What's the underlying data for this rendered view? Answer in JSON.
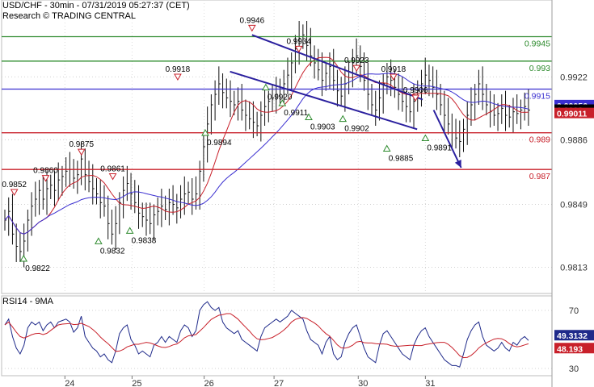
{
  "header": {
    "title": "USD/CHF - 30min - 07/31/2019 05:27:37 (CET)",
    "source": "Research © TRADING CENTRAL"
  },
  "chart_data": [
    {
      "type": "line",
      "panel": "price",
      "y_axis_ticks": [
        "0.9922",
        "0.9886",
        "0.9849",
        "0.9813"
      ],
      "ylim": [
        0.9798,
        0.9966
      ],
      "levels": [
        {
          "label": "0.9945",
          "value": 0.9945,
          "color": "#2e8b2e"
        },
        {
          "label": "0.993",
          "value": 0.9931,
          "color": "#2e8b2e"
        },
        {
          "label": "0.9915",
          "value": 0.9915,
          "color": "#3a2fd0"
        },
        {
          "label": "0.989",
          "value": 0.989,
          "color": "#c8202a"
        },
        {
          "label": "0.987",
          "value": 0.9869,
          "color": "#c8202a"
        }
      ],
      "badges": [
        {
          "label": "0.99056",
          "value": 0.99056,
          "bg": "#3a2fd0",
          "fg": "#ffffff"
        },
        {
          "label": "0.9903",
          "value": 0.9903,
          "bg": "#000000",
          "fg": "#ffffff"
        },
        {
          "label": "0.99011",
          "value": 0.99011,
          "bg": "#c8202a",
          "fg": "#ffffff"
        }
      ],
      "pivots": [
        {
          "label": "0.9852",
          "value": 0.9852,
          "dir": "high",
          "x": 0.023
        },
        {
          "label": "0.9822",
          "value": 0.9822,
          "dir": "low",
          "x": 0.04
        },
        {
          "label": "0.9860",
          "value": 0.986,
          "dir": "high",
          "x": 0.08
        },
        {
          "label": "0.9875",
          "value": 0.9875,
          "dir": "high",
          "x": 0.145
        },
        {
          "label": "0.9832",
          "value": 0.9832,
          "dir": "low",
          "x": 0.176
        },
        {
          "label": "0.9861",
          "value": 0.9861,
          "dir": "high",
          "x": 0.202
        },
        {
          "label": "0.9838",
          "value": 0.9838,
          "dir": "low",
          "x": 0.233
        },
        {
          "label": "0.9918",
          "value": 0.9918,
          "dir": "high",
          "x": 0.32
        },
        {
          "label": "0.9894",
          "value": 0.9894,
          "dir": "low",
          "x": 0.37
        },
        {
          "label": "0.9946",
          "value": 0.9946,
          "dir": "high",
          "x": 0.455
        },
        {
          "label": "0.9920",
          "value": 0.992,
          "dir": "low",
          "x": 0.48
        },
        {
          "label": "0.9911",
          "value": 0.9911,
          "dir": "low",
          "x": 0.51
        },
        {
          "label": "0.9934",
          "value": 0.9934,
          "dir": "high",
          "x": 0.54
        },
        {
          "label": "0.9903",
          "value": 0.9903,
          "dir": "low",
          "x": 0.558
        },
        {
          "label": "0.9902",
          "value": 0.9902,
          "dir": "low",
          "x": 0.62
        },
        {
          "label": "0.9923",
          "value": 0.9923,
          "dir": "high",
          "x": 0.645
        },
        {
          "label": "0.9918",
          "value": 0.9918,
          "dir": "high",
          "x": 0.712
        },
        {
          "label": "0.9885",
          "value": 0.9885,
          "dir": "low",
          "x": 0.7
        },
        {
          "label": "0.9906",
          "value": 0.9906,
          "dir": "high",
          "x": 0.752
        },
        {
          "label": "0.9891",
          "value": 0.9891,
          "dir": "low",
          "x": 0.77
        }
      ],
      "channel": {
        "upper": [
          {
            "x": 0.455,
            "y": 0.9946
          },
          {
            "x": 0.765,
            "y": 0.9909
          }
        ],
        "lower": [
          {
            "x": 0.415,
            "y": 0.9925
          },
          {
            "x": 0.755,
            "y": 0.9892
          }
        ]
      },
      "forecast_arrow": [
        {
          "x": 0.785,
          "y": 0.9903
        },
        {
          "x": 0.835,
          "y": 0.987
        }
      ],
      "close": [
        0.984,
        0.9845,
        0.9832,
        0.9825,
        0.9822,
        0.9828,
        0.984,
        0.9848,
        0.9852,
        0.9857,
        0.9852,
        0.9858,
        0.986,
        0.9857,
        0.9863,
        0.9865,
        0.9868,
        0.9869,
        0.9864,
        0.9866,
        0.9875,
        0.9866,
        0.9862,
        0.9858,
        0.9855,
        0.985,
        0.9848,
        0.9838,
        0.9832,
        0.9838,
        0.985,
        0.9857,
        0.9861,
        0.9855,
        0.985,
        0.9844,
        0.9842,
        0.984,
        0.9838,
        0.9843,
        0.9845,
        0.9848,
        0.9846,
        0.985,
        0.9849,
        0.9847,
        0.9852,
        0.9855,
        0.9856,
        0.9852,
        0.9855,
        0.9868,
        0.9882,
        0.9895,
        0.9906,
        0.9912,
        0.9918,
        0.9913,
        0.991,
        0.9908,
        0.9906,
        0.9908,
        0.9903,
        0.99,
        0.9898,
        0.9896,
        0.9894,
        0.99,
        0.9905,
        0.9908,
        0.991,
        0.9912,
        0.9915,
        0.9918,
        0.9923,
        0.993,
        0.9938,
        0.9944,
        0.9946,
        0.994,
        0.9934,
        0.993,
        0.9926,
        0.992,
        0.9924,
        0.9928,
        0.992,
        0.9914,
        0.9911,
        0.9918,
        0.9925,
        0.993,
        0.9934,
        0.9928,
        0.992,
        0.9912,
        0.9906,
        0.9903,
        0.991,
        0.9918,
        0.9922,
        0.992,
        0.9916,
        0.9912,
        0.9908,
        0.9905,
        0.9902,
        0.9908,
        0.9914,
        0.9918,
        0.9923,
        0.992,
        0.9916,
        0.9912,
        0.9906,
        0.99,
        0.9895,
        0.989,
        0.9887,
        0.9885,
        0.9892,
        0.99,
        0.9906,
        0.9912,
        0.9918,
        0.9912,
        0.9906,
        0.9902,
        0.99,
        0.9901,
        0.9904,
        0.99,
        0.9899,
        0.9902,
        0.9901,
        0.9903,
        0.9905,
        0.9903
      ]
    },
    {
      "type": "line",
      "panel": "rsi",
      "title": "RSI14 - 9MA",
      "y_axis_ticks": [
        "70",
        "30"
      ],
      "ylim": [
        25,
        80
      ],
      "x_ticks": [
        {
          "label": "24",
          "x": 0.115
        },
        {
          "label": "25",
          "x": 0.237
        },
        {
          "label": "26",
          "x": 0.368
        },
        {
          "label": "27",
          "x": 0.495
        },
        {
          "label": "30",
          "x": 0.648
        },
        {
          "label": "31",
          "x": 0.77
        }
      ],
      "badges": [
        {
          "label": "49.3132",
          "value": 49.3132,
          "bg": "#1f2a8a",
          "fg": "#ffffff"
        },
        {
          "label": "48.193",
          "value": 48.193,
          "bg": "#c8202a",
          "fg": "#ffffff"
        }
      ],
      "rsi": [
        60,
        64,
        52,
        44,
        40,
        46,
        58,
        62,
        60,
        62,
        56,
        60,
        62,
        58,
        62,
        63,
        64,
        62,
        55,
        58,
        66,
        52,
        48,
        44,
        42,
        38,
        40,
        36,
        34,
        42,
        54,
        58,
        60,
        50,
        46,
        40,
        42,
        40,
        38,
        46,
        48,
        52,
        48,
        52,
        50,
        48,
        56,
        60,
        58,
        52,
        56,
        70,
        74,
        76,
        72,
        70,
        72,
        62,
        58,
        56,
        54,
        56,
        50,
        48,
        46,
        44,
        42,
        52,
        58,
        60,
        62,
        64,
        62,
        64,
        66,
        70,
        68,
        66,
        64,
        56,
        50,
        48,
        46,
        40,
        48,
        52,
        40,
        36,
        38,
        48,
        54,
        58,
        60,
        52,
        44,
        38,
        36,
        34,
        46,
        54,
        56,
        52,
        48,
        44,
        40,
        38,
        36,
        46,
        52,
        56,
        58,
        52,
        48,
        44,
        40,
        36,
        34,
        32,
        32,
        31,
        40,
        50,
        56,
        60,
        62,
        52,
        46,
        44,
        42,
        44,
        48,
        44,
        42,
        48,
        46,
        50,
        52,
        49.3
      ]
    }
  ]
}
